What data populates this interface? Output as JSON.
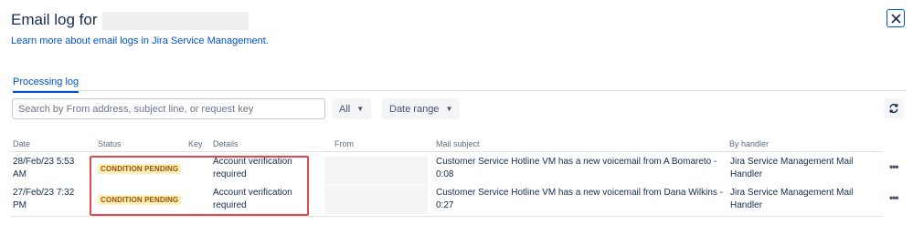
{
  "header": {
    "title": "Email log for",
    "learn_more": "Learn more about email logs in Jira Service Management."
  },
  "tabs": [
    {
      "label": "Processing log",
      "active": true
    }
  ],
  "toolbar": {
    "search_placeholder": "Search by From address, subject line, or request key",
    "status_filter": "All",
    "date_filter": "Date range"
  },
  "table": {
    "columns": {
      "date": "Date",
      "status": "Status",
      "key": "Key",
      "details": "Details",
      "from": "From",
      "subject": "Mail subject",
      "handler": "By handler"
    },
    "rows": [
      {
        "date_line1": "28/Feb/23 5:53",
        "date_line2": "AM",
        "status": "CONDITION PENDING",
        "details_line1": "Account verification",
        "details_line2": "required",
        "subject_line1": "Customer Service Hotline VM has a new voicemail from A Bomareto -",
        "subject_line2": "0:08",
        "handler_line1": "Jira Service Management Mail",
        "handler_line2": "Handler"
      },
      {
        "date_line1": "27/Feb/23 7:32",
        "date_line2": "PM",
        "status": "CONDITION PENDING",
        "details_line1": "Account verification",
        "details_line2": "required",
        "subject_line1": "Customer Service Hotline VM has a new voicemail from Dana Wilkins -",
        "subject_line2": "0:27",
        "handler_line1": "Jira Service Management Mail",
        "handler_line2": "Handler"
      }
    ]
  },
  "colors": {
    "link": "#0052cc",
    "badge_bg": "#fff0b3",
    "badge_text": "#974f0c",
    "highlight": "#e5484d"
  }
}
